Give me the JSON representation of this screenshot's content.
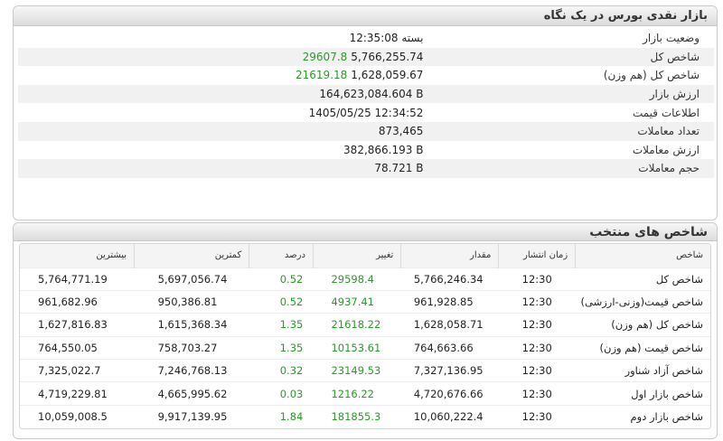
{
  "summary": {
    "title": "بازار نقدی بورس در یک نگاه",
    "rows": [
      {
        "label": "وضعیت بازار",
        "value": "بسته 12:35:08",
        "change": ""
      },
      {
        "label": "شاخص کل",
        "value": "5,766,255.74",
        "change": "29607.8"
      },
      {
        "label": "شاخص کل (هم وزن)",
        "value": "1,628,059.67",
        "change": "21619.18"
      },
      {
        "label": "ارزش بازار",
        "value": "164,623,084.604 B",
        "change": ""
      },
      {
        "label": "اطلاعات قیمت",
        "value": "1405/05/25 12:34:52",
        "change": ""
      },
      {
        "label": "تعداد معاملات",
        "value": "873,465",
        "change": ""
      },
      {
        "label": "ارزش معاملات",
        "value": "382,866.193 B",
        "change": ""
      },
      {
        "label": "حجم معاملات",
        "value": "78.721 B",
        "change": ""
      }
    ]
  },
  "indices": {
    "title": "شاخص های منتخب",
    "columns": [
      "شاخص",
      "زمان انتشار",
      "مقدار",
      "تغییر",
      "درصد",
      "کمترین",
      "بیشترین"
    ],
    "rows": [
      {
        "name": "شاخص کل",
        "time": "12:30",
        "value": "5,766,246.34",
        "change": "29598.4",
        "percent": "0.52",
        "low": "5,697,056.74",
        "high": "5,764,771.19"
      },
      {
        "name": "شاخص قیمت(وزنی-ارزشی)",
        "time": "12:30",
        "value": "961,928.85",
        "change": "4937.41",
        "percent": "0.52",
        "low": "950,386.81",
        "high": "961,682.96"
      },
      {
        "name": "شاخص کل (هم وزن)",
        "time": "12:30",
        "value": "1,628,058.71",
        "change": "21618.22",
        "percent": "1.35",
        "low": "1,615,368.34",
        "high": "1,627,816.83"
      },
      {
        "name": "شاخص قیمت (هم وزن)",
        "time": "12:30",
        "value": "764,663.66",
        "change": "10153.61",
        "percent": "1.35",
        "low": "758,703.27",
        "high": "764,550.05"
      },
      {
        "name": "شاخص آزاد شناور",
        "time": "12:30",
        "value": "7,327,136.95",
        "change": "23149.53",
        "percent": "0.32",
        "low": "7,246,768.13",
        "high": "7,325,022.7"
      },
      {
        "name": "شاخص بازار اول",
        "time": "12:30",
        "value": "4,720,676.66",
        "change": "1216.22",
        "percent": "0.03",
        "low": "4,665,995.62",
        "high": "4,719,229.81"
      },
      {
        "name": "شاخص بازار دوم",
        "time": "12:30",
        "value": "10,060,222.4",
        "change": "181855.3",
        "percent": "1.84",
        "low": "9,917,139.95",
        "high": "10,059,008.5"
      }
    ]
  },
  "colors": {
    "positive": "#2a9a2a",
    "header_bg": "#dcdcdc"
  }
}
